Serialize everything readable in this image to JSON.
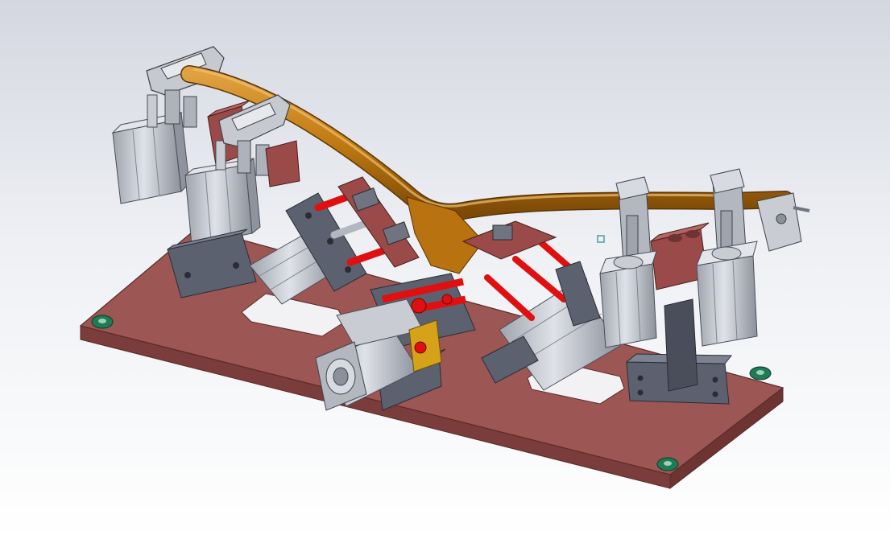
{
  "scene": {
    "subject": "",
    "colors": {
      "plate": "#9c5654",
      "plate_side": "#7a3d3b",
      "plate_edge": "#5b2a28",
      "tube": "#c07a12",
      "tube_dark": "#8a5308",
      "gray": "#b3b7c0",
      "gray_light": "#d7dae1",
      "gray_dark": "#6f7480",
      "block_dark": "#5c6170",
      "pin_red": "#e01010",
      "brass": "#d5a21a",
      "washer": "#1f7a55",
      "bracket_red": "#9a4a48"
    }
  }
}
